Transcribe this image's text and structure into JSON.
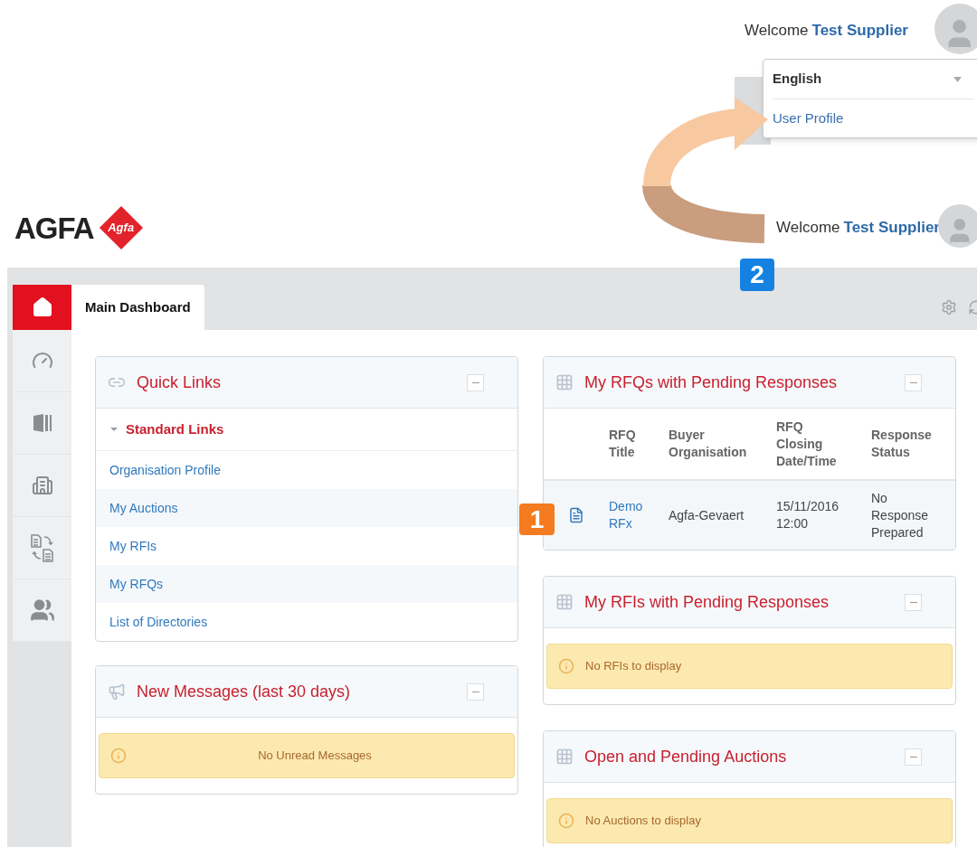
{
  "top_bar": {
    "welcome": "Welcome",
    "user": "Test Supplier"
  },
  "user_menu": {
    "language": "English",
    "items": [
      "User Profile"
    ]
  },
  "header": {
    "logo_text": "AGFA",
    "logo_badge": "Agfa",
    "welcome": "Welcome",
    "user": "Test Supplier"
  },
  "annotations": [
    {
      "label": "2",
      "color": "#1582e2"
    },
    {
      "label": "1",
      "color": "#f47b20"
    }
  ],
  "sidebar": {
    "items": [
      {
        "kind": "home",
        "selected": true
      },
      {
        "kind": "gauge",
        "selected": false
      },
      {
        "kind": "book",
        "selected": false
      },
      {
        "kind": "building",
        "selected": false
      },
      {
        "kind": "documents",
        "selected": false
      },
      {
        "kind": "people",
        "selected": false
      }
    ]
  },
  "tabs": [
    {
      "label": "Main Dashboard",
      "selected": true
    }
  ],
  "left_panels": [
    {
      "kind": "links",
      "title": "Quick Links",
      "group": {
        "label": "Standard Links",
        "expanded": true,
        "links": [
          "Organisation Profile",
          "My Auctions",
          "My RFIs",
          "My RFQs",
          "List of Directories"
        ]
      }
    },
    {
      "kind": "alert",
      "title": "New Messages (last 30 days)",
      "message": "No Unread Messages"
    }
  ],
  "right_panels": [
    {
      "kind": "table",
      "title": "My RFQs with Pending Responses",
      "columns": [
        "RFQ Title",
        "Buyer Organisation",
        "RFQ Closing Date/Time",
        "Response Status"
      ],
      "rows": [
        {
          "title": "Demo RFx",
          "buyer": "Agfa-Gevaert",
          "closing": "15/11/2016 12:00",
          "status": "No Response Prepared"
        }
      ]
    },
    {
      "kind": "alert",
      "title": "My RFIs with Pending Responses",
      "message": "No RFIs to display"
    },
    {
      "kind": "alert",
      "title": "Open and Pending Auctions",
      "message": "No Auctions to display"
    }
  ]
}
